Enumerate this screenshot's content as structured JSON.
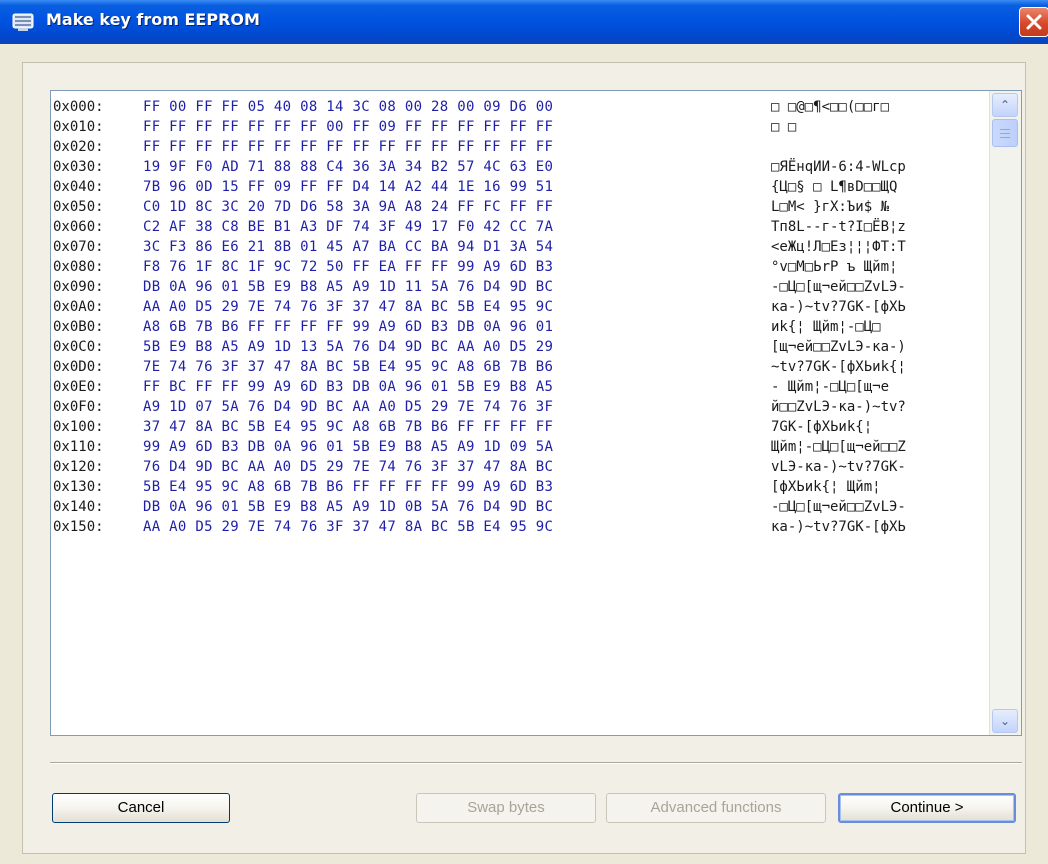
{
  "window": {
    "title": "Make key from EEPROM",
    "close_icon": "close-icon"
  },
  "hex_rows": [
    {
      "addr": "0x000:",
      "bytes": "FF 00 FF FF 05 40 08 14 3C 08 00 28 00 09 D6 00",
      "ascii": "□ □@□¶<□□(□□г□"
    },
    {
      "addr": "0x010:",
      "bytes": "FF FF FF FF FF FF FF 00 FF 09 FF FF FF FF FF FF",
      "ascii": "□ □"
    },
    {
      "addr": "0x020:",
      "bytes": "FF FF FF FF FF FF FF FF FF FF FF FF FF FF FF FF",
      "ascii": ""
    },
    {
      "addr": "0x030:",
      "bytes": "19 9F F0 AD 71 88 88 C4 36 3A 34 B2 57 4C 63 E0",
      "ascii": "□ЯЁнqИИ-6:4-WLcр"
    },
    {
      "addr": "0x040:",
      "bytes": "7B 96 0D 15 FF 09 FF FF D4 14 A2 44 1E 16 99 51",
      "ascii": "{Ц□§ □ L¶вD□□ЩQ"
    },
    {
      "addr": "0x050:",
      "bytes": "C0 1D 8C 3C 20 7D D6 58 3A 9A A8 24 FF FC FF FF",
      "ascii": "L□М< }гX:Ъи$ №"
    },
    {
      "addr": "0x060:",
      "bytes": "C2 AF 38 C8 BE B1 A3 DF 74 3F 49 17 F0 42 CC 7A",
      "ascii": "Тп8L--г-t?I□ЁВ¦z"
    },
    {
      "addr": "0x070:",
      "bytes": "3C F3 86 E6 21 8B 01 45 A7 BA CC BA 94 D1 3A 54",
      "ascii": "<еЖц!Л□Eз¦¦¦ФТ:Т"
    },
    {
      "addr": "0x080:",
      "bytes": "F8 76 1F 8C 1F 9C 72 50 FF EA FF FF 99 A9 6D B3",
      "ascii": "°v□М□ЬrР ъ  Щйm¦"
    },
    {
      "addr": "0x090:",
      "bytes": "DB 0A 96 01 5B E9 B8 A5 A9 1D 11 5A 76 D4 9D BC",
      "ascii": "-□Ц□[щ¬ей□□ZvLЭ-"
    },
    {
      "addr": "0x0A0:",
      "bytes": "AA A0 D5 29 7E 74 76 3F 37 47 8A BC 5B E4 95 9C",
      "ascii": "ка-)~tv?7GК-[фХЬ"
    },
    {
      "addr": "0x0B0:",
      "bytes": "A8 6B 7B B6 FF FF FF FF 99 A9 6D B3 DB 0A 96 01",
      "ascii": "иk{¦    Щйm¦-□Ц□"
    },
    {
      "addr": "0x0C0:",
      "bytes": "5B E9 B8 A5 A9 1D 13 5A 76 D4 9D BC AA A0 D5 29",
      "ascii": "[щ¬ей□□ZvLЭ-ка-)"
    },
    {
      "addr": "0x0D0:",
      "bytes": "7E 74 76 3F 37 47 8A BC 5B E4 95 9C A8 6B 7B B6",
      "ascii": "~tv?7GК-[фХЬиk{¦"
    },
    {
      "addr": "0x0E0:",
      "bytes": "FF BC FF FF 99 A9 6D B3 DB 0A 96 01 5B E9 B8 A5",
      "ascii": " -  Щйm¦-□Ц□[щ¬е"
    },
    {
      "addr": "0x0F0:",
      "bytes": "A9 1D 07 5A 76 D4 9D BC AA A0 D5 29 7E 74 76 3F",
      "ascii": "й□□ZvLЭ-ка-)~tv?"
    },
    {
      "addr": "0x100:",
      "bytes": "37 47 8A BC 5B E4 95 9C A8 6B 7B B6 FF FF FF FF",
      "ascii": "7GК-[фХЬиk{¦"
    },
    {
      "addr": "0x110:",
      "bytes": "99 A9 6D B3 DB 0A 96 01 5B E9 B8 A5 A9 1D 09 5A",
      "ascii": "Щйm¦-□Ц□[щ¬ей□□Z"
    },
    {
      "addr": "0x120:",
      "bytes": "76 D4 9D BC AA A0 D5 29 7E 74 76 3F 37 47 8A BC",
      "ascii": "vLЭ-ка-)~tv?7GК-"
    },
    {
      "addr": "0x130:",
      "bytes": "5B E4 95 9C A8 6B 7B B6 FF FF FF FF 99 A9 6D B3",
      "ascii": "[фХЬиk{¦    Щйm¦"
    },
    {
      "addr": "0x140:",
      "bytes": "DB 0A 96 01 5B E9 B8 A5 A9 1D 0B 5A 76 D4 9D BC",
      "ascii": "-□Ц□[щ¬ей□□ZvLЭ-"
    },
    {
      "addr": "0x150:",
      "bytes": "AA A0 D5 29 7E 74 76 3F 37 47 8A BC 5B E4 95 9C",
      "ascii": "ка-)~tv?7GК-[фХЬ"
    }
  ],
  "scrollbar": {
    "up_glyph": "⌃",
    "down_glyph": "⌄"
  },
  "buttons": {
    "cancel": "Cancel",
    "swap_bytes": "Swap bytes",
    "advanced_functions": "Advanced functions",
    "continue": "Continue >"
  },
  "colors": {
    "titlebar": "#0053e1",
    "hex_bytes": "#1f1fa8",
    "window_bg": "#ece9d8",
    "close_button": "#d7482b"
  }
}
